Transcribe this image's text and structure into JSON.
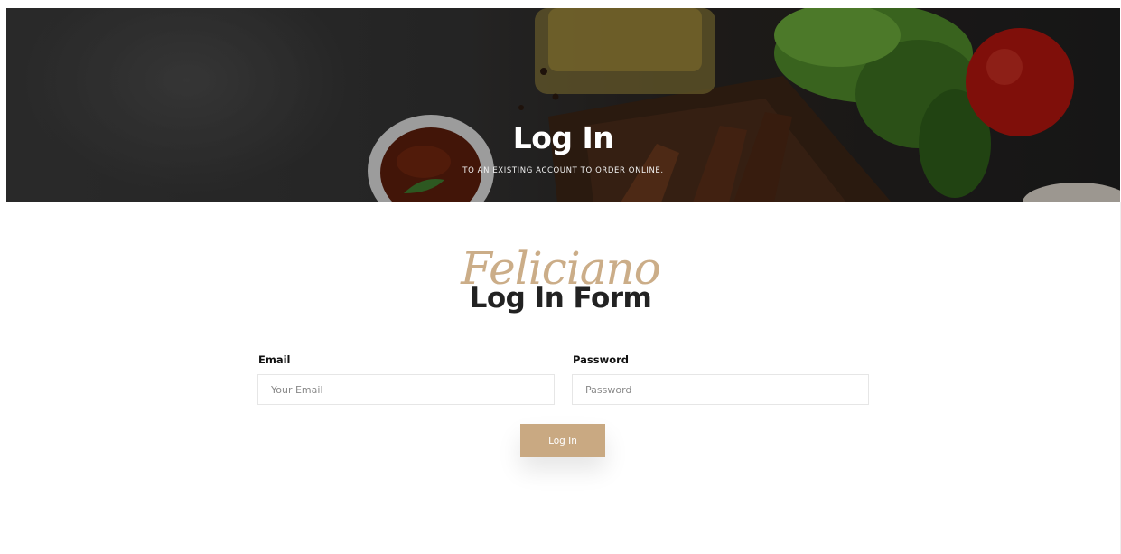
{
  "hero": {
    "title": "Log In",
    "subtitle": "TO AN EXISTING ACCOUNT TO ORDER ONLINE."
  },
  "form": {
    "brand_script": "Feliciano",
    "title": "Log In Form",
    "email": {
      "label": "Email",
      "placeholder": "Your Email",
      "value": ""
    },
    "password": {
      "label": "Password",
      "placeholder": "Password",
      "value": ""
    },
    "submit_label": "Log In"
  },
  "colors": {
    "accent": "#c9a982",
    "heading": "#222222"
  }
}
